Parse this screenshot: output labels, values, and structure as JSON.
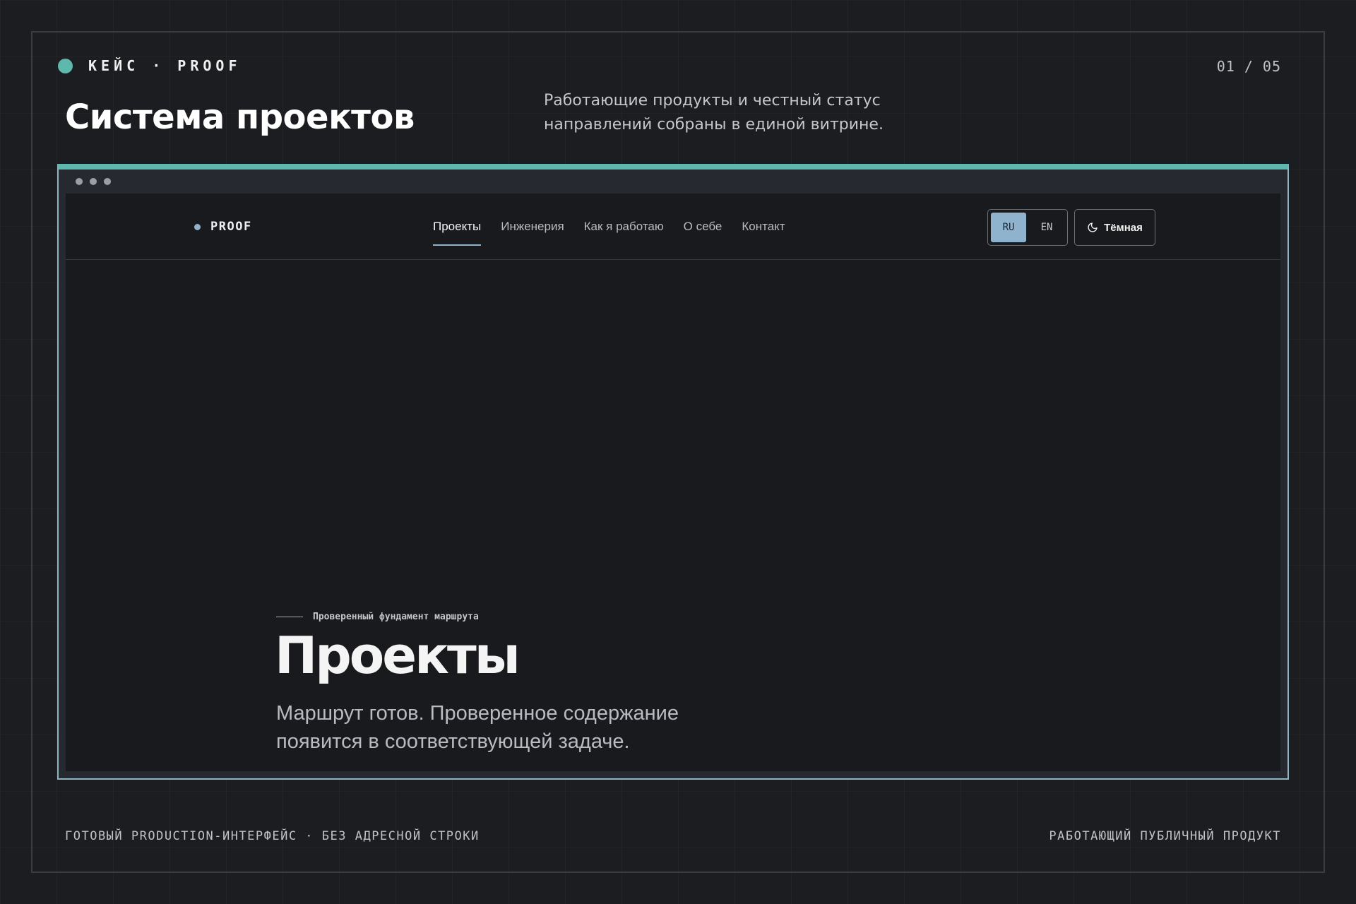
{
  "slide": {
    "brand": "КЕЙС · PROOF",
    "counter": "01 / 05",
    "title": "Система проектов",
    "subtitle_line1": "Работающие продукты и честный статус",
    "subtitle_line2": "направлений собраны в единой витрине.",
    "footer_left": "ГОТОВЫЙ PRODUCTION-ИНТЕРФЕЙС · БЕЗ АДРЕСНОЙ СТРОКИ",
    "footer_right": "РАБОТАЮЩИЙ ПУБЛИЧНЫЙ ПРОДУКТ"
  },
  "site": {
    "logo": "PROOF",
    "nav": [
      {
        "label": "Проекты",
        "active": true
      },
      {
        "label": "Инженерия",
        "active": false
      },
      {
        "label": "Как я работаю",
        "active": false
      },
      {
        "label": "О себе",
        "active": false
      },
      {
        "label": "Контакт",
        "active": false
      }
    ],
    "lang": {
      "ru": "RU",
      "en": "EN",
      "selected": "RU"
    },
    "theme_label": "Тёмная",
    "theme_icon": "moon-icon"
  },
  "hero": {
    "eyebrow": "Проверенный фундамент маршрута",
    "title": "Проекты",
    "desc_line1": "Маршрут готов. Проверенное содержание",
    "desc_line2": "появится в соответствующей задаче."
  },
  "colors": {
    "accent": "#5fb8ad",
    "site_accent": "#8fb3cc",
    "background": "#1b1d20",
    "viewport_bg": "#191a1e"
  }
}
